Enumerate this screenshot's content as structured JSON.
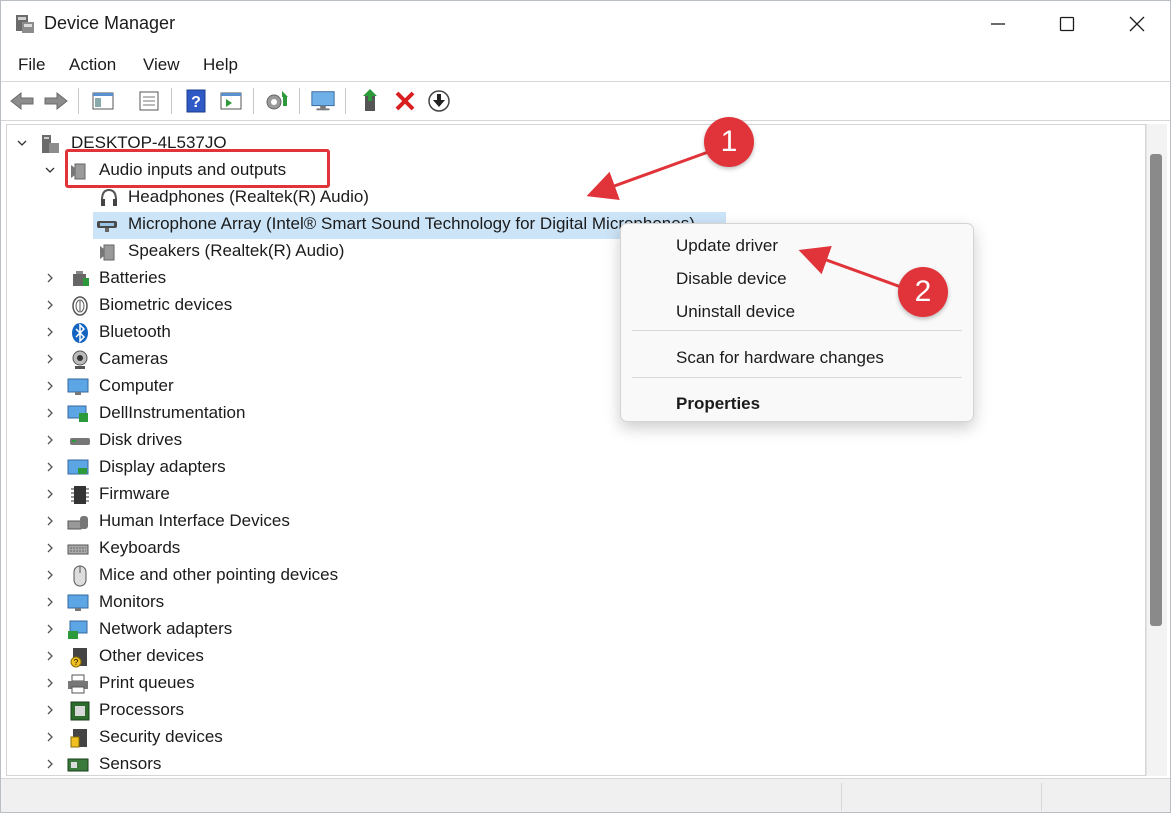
{
  "window": {
    "title": "Device Manager",
    "minimize_icon": "minimize-icon",
    "maximize_icon": "maximize-icon",
    "close_icon": "close-icon"
  },
  "menu": {
    "items": [
      "File",
      "Action",
      "View",
      "Help"
    ]
  },
  "toolbar": {
    "buttons": [
      "back-arrow-icon",
      "forward-arrow-icon",
      "show-hide-console-tree-icon",
      "properties-sheet-icon",
      "help-icon",
      "action-pane-icon",
      "scan-hardware-icon",
      "monitor-icon",
      "update-driver-icon",
      "uninstall-x-icon",
      "disable-device-icon"
    ]
  },
  "tree": {
    "root": "DESKTOP-4L537JO",
    "expanded_category": "Audio inputs and outputs",
    "children": [
      "Headphones (Realtek(R) Audio)",
      "Microphone Array (Intel® Smart Sound Technology for Digital Microphones)",
      "Speakers (Realtek(R) Audio)"
    ],
    "categories": [
      "Batteries",
      "Biometric devices",
      "Bluetooth",
      "Cameras",
      "Computer",
      "DellInstrumentation",
      "Disk drives",
      "Display adapters",
      "Firmware",
      "Human Interface Devices",
      "Keyboards",
      "Mice and other pointing devices",
      "Monitors",
      "Network adapters",
      "Other devices",
      "Print queues",
      "Processors",
      "Security devices",
      "Sensors"
    ]
  },
  "context_menu": {
    "update": "Update driver",
    "disable": "Disable device",
    "uninstall": "Uninstall device",
    "scan": "Scan for hardware changes",
    "properties": "Properties"
  },
  "annotations": {
    "step1": "1",
    "step2": "2"
  },
  "colors": {
    "accent_red": "#e0343a",
    "selection": "#cce4f7"
  }
}
